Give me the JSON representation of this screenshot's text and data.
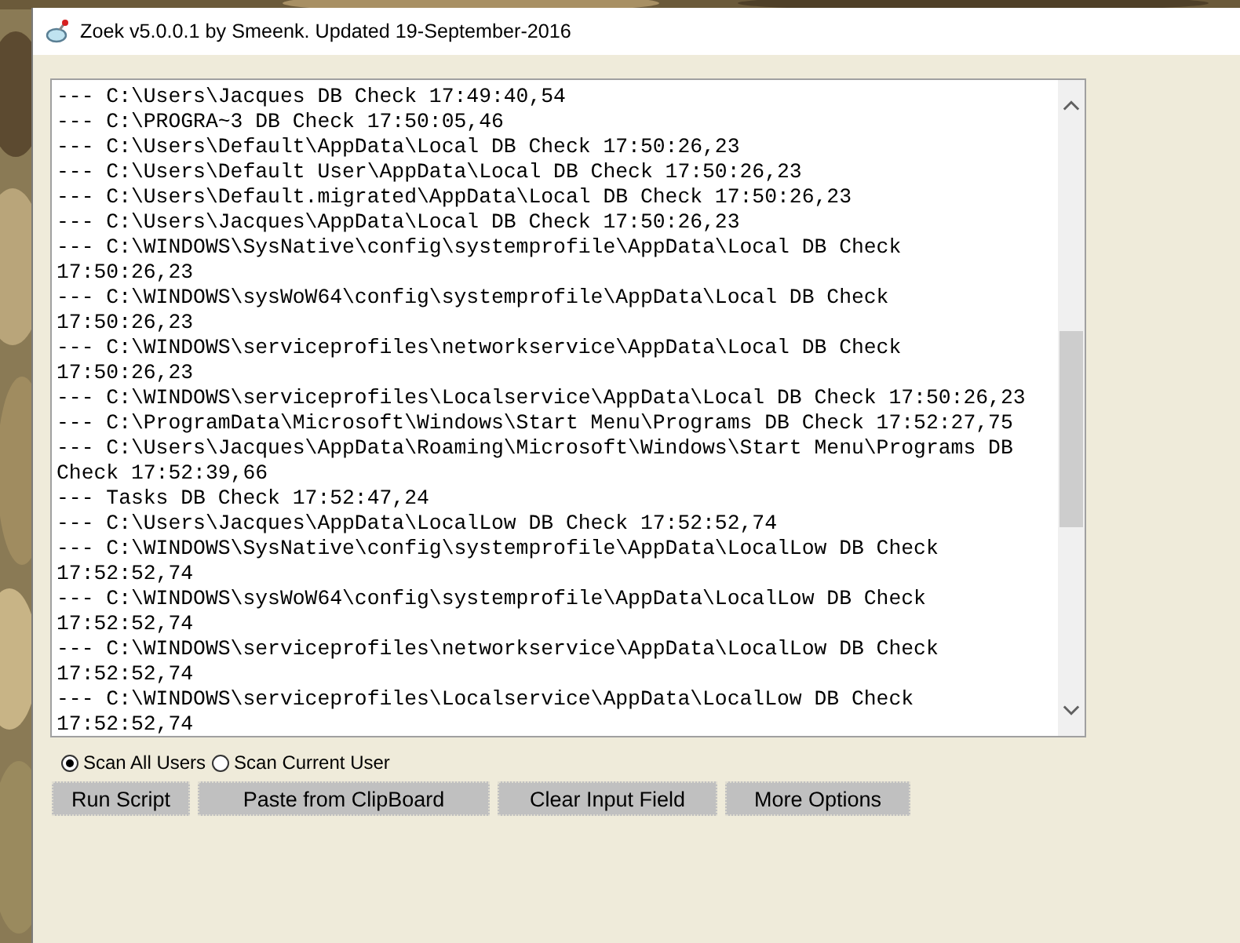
{
  "window": {
    "title": "Zoek v5.0.0.1 by Smeenk. Updated 19-September-2016"
  },
  "log": {
    "lines": [
      "--- C:\\Users\\Jacques DB Check 17:49:40,54",
      "--- C:\\PROGRA~3 DB Check 17:50:05,46",
      "--- C:\\Users\\Default\\AppData\\Local DB Check 17:50:26,23",
      "--- C:\\Users\\Default User\\AppData\\Local DB Check 17:50:26,23",
      "--- C:\\Users\\Default.migrated\\AppData\\Local DB Check 17:50:26,23",
      "--- C:\\Users\\Jacques\\AppData\\Local DB Check 17:50:26,23",
      "--- C:\\WINDOWS\\SysNative\\config\\systemprofile\\AppData\\Local DB Check",
      "17:50:26,23",
      "--- C:\\WINDOWS\\sysWoW64\\config\\systemprofile\\AppData\\Local DB Check",
      "17:50:26,23",
      "--- C:\\WINDOWS\\serviceprofiles\\networkservice\\AppData\\Local DB Check",
      "17:50:26,23",
      "--- C:\\WINDOWS\\serviceprofiles\\Localservice\\AppData\\Local DB Check 17:50:26,23",
      "--- C:\\ProgramData\\Microsoft\\Windows\\Start Menu\\Programs DB Check 17:52:27,75",
      "--- C:\\Users\\Jacques\\AppData\\Roaming\\Microsoft\\Windows\\Start Menu\\Programs DB",
      "Check 17:52:39,66",
      "--- Tasks DB Check 17:52:47,24",
      "--- C:\\Users\\Jacques\\AppData\\LocalLow DB Check 17:52:52,74",
      "--- C:\\WINDOWS\\SysNative\\config\\systemprofile\\AppData\\LocalLow DB Check",
      "17:52:52,74",
      "--- C:\\WINDOWS\\sysWoW64\\config\\systemprofile\\AppData\\LocalLow DB Check",
      "17:52:52,74",
      "--- C:\\WINDOWS\\serviceprofiles\\networkservice\\AppData\\LocalLow DB Check",
      "17:52:52,74",
      "--- C:\\WINDOWS\\serviceprofiles\\Localservice\\AppData\\LocalLow DB Check",
      "17:52:52,74"
    ]
  },
  "scan_options": [
    {
      "label": "Scan All Users",
      "selected": true
    },
    {
      "label": "Scan Current User",
      "selected": false
    }
  ],
  "buttons": [
    "Run Script",
    "Paste from ClipBoard",
    "Clear Input Field",
    "More Options"
  ]
}
